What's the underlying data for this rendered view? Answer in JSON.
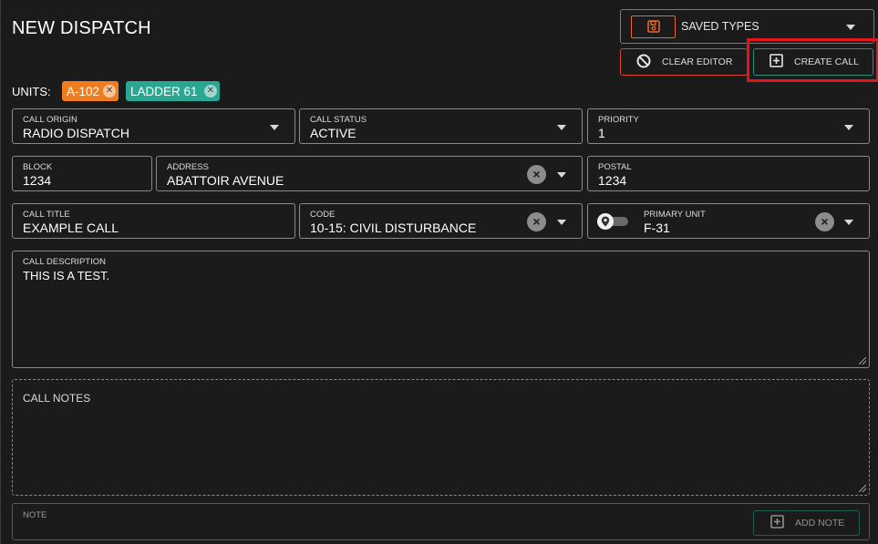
{
  "header": {
    "title": "NEW DISPATCH"
  },
  "saved_types": {
    "label": "SAVED TYPES",
    "icon": "save-icon"
  },
  "toolbar": {
    "clear_label": "CLEAR EDITOR",
    "create_label": "CREATE CALL"
  },
  "units": {
    "label": "UNITS:",
    "chips": [
      {
        "label": "A-102",
        "color": "#ef7d1f"
      },
      {
        "label": "LADDER 61",
        "color": "#2aa792"
      }
    ]
  },
  "form": {
    "call_origin": {
      "label": "CALL ORIGIN",
      "value": "RADIO DISPATCH"
    },
    "call_status": {
      "label": "CALL STATUS",
      "value": "ACTIVE"
    },
    "priority": {
      "label": "PRIORITY",
      "value": "1"
    },
    "block": {
      "label": "BLOCK",
      "value": "1234"
    },
    "address": {
      "label": "ADDRESS",
      "value": "ABATTOIR AVENUE"
    },
    "postal": {
      "label": "POSTAL",
      "value": "1234"
    },
    "call_title": {
      "label": "CALL TITLE",
      "value": "EXAMPLE CALL"
    },
    "code": {
      "label": "CODE",
      "value": "10-15: CIVIL DISTURBANCE"
    },
    "primary_unit": {
      "label": "PRIMARY UNIT",
      "value": "F-31"
    },
    "call_description": {
      "label": "CALL DESCRIPTION",
      "value": "THIS IS A TEST."
    },
    "call_notes": {
      "label": "CALL NOTES"
    },
    "note": {
      "label": "NOTE"
    }
  },
  "add_note": {
    "label": "ADD NOTE"
  },
  "colors": {
    "background": "#1b1b1b",
    "accent_orange": "#e8692a",
    "accent_red": "#d9482d",
    "accent_teal": "#2a8f7a",
    "highlight_red": "#e3141b"
  }
}
